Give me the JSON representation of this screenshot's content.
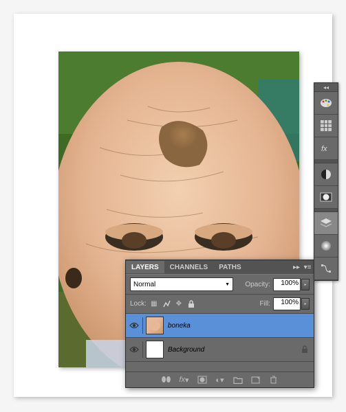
{
  "panel": {
    "tabs": {
      "layers": "LAYERS",
      "channels": "CHANNELS",
      "paths": "PATHS"
    },
    "blend_mode": "Normal",
    "opacity_label": "Opacity:",
    "opacity_value": "100%",
    "lock_label": "Lock:",
    "fill_label": "Fill:",
    "fill_value": "100%",
    "layers": [
      {
        "name": "boneka"
      },
      {
        "name": "Background"
      }
    ]
  }
}
